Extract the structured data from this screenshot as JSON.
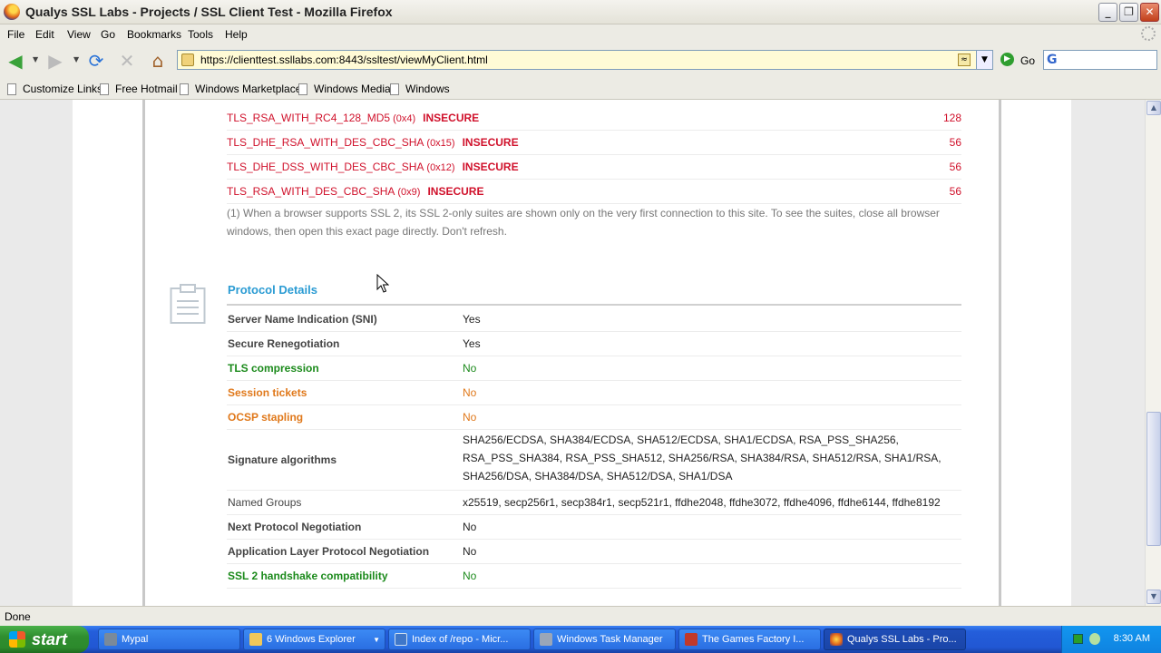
{
  "window": {
    "title": "Qualys SSL Labs - Projects / SSL Client Test - Mozilla Firefox",
    "min": "_",
    "max": "❐",
    "close": "✕"
  },
  "menu": [
    "File",
    "Edit",
    "View",
    "Go",
    "Bookmarks",
    "Tools",
    "Help"
  ],
  "nav": {
    "url": "https://clienttest.ssllabs.com:8443/ssltest/viewMyClient.html",
    "go_label": "Go"
  },
  "bookmarks": [
    "Customize Links",
    "Free Hotmail",
    "Windows Marketplace",
    "Windows Media",
    "Windows"
  ],
  "suites": [
    {
      "name": "TLS_RSA_WITH_RC4_128_MD5",
      "code": "(0x4)",
      "flag": "INSECURE",
      "bits": "128"
    },
    {
      "name": "TLS_DHE_RSA_WITH_DES_CBC_SHA",
      "code": "(0x15)",
      "flag": "INSECURE",
      "bits": "56"
    },
    {
      "name": "TLS_DHE_DSS_WITH_DES_CBC_SHA",
      "code": "(0x12)",
      "flag": "INSECURE",
      "bits": "56"
    },
    {
      "name": "TLS_RSA_WITH_DES_CBC_SHA",
      "code": "(0x9)",
      "flag": "INSECURE",
      "bits": "56"
    }
  ],
  "footnote": "(1) When a browser supports SSL 2, its SSL 2-only suites are shown only on the very first connection to this site. To see the suites, close all browser windows, then open this exact page directly. Don't refresh.",
  "protocol": {
    "title": "Protocol Details",
    "rows": [
      {
        "label": "Server Name Indication (SNI)",
        "value": "Yes",
        "tone": "normal"
      },
      {
        "label": "Secure Renegotiation",
        "value": "Yes",
        "tone": "normal"
      },
      {
        "label": "TLS compression",
        "value": "No",
        "tone": "good"
      },
      {
        "label": "Session tickets",
        "value": "No",
        "tone": "warn"
      },
      {
        "label": "OCSP stapling",
        "value": "No",
        "tone": "warn"
      },
      {
        "label": "Signature algorithms",
        "value": "SHA256/ECDSA, SHA384/ECDSA, SHA512/ECDSA, SHA1/ECDSA, RSA_PSS_SHA256, RSA_PSS_SHA384, RSA_PSS_SHA512, SHA256/RSA, SHA384/RSA, SHA512/RSA, SHA1/RSA, SHA256/DSA, SHA384/DSA, SHA512/DSA, SHA1/DSA",
        "tone": "normal"
      },
      {
        "label": "Named Groups",
        "value": "x25519, secp256r1, secp384r1, secp521r1, ffdhe2048, ffdhe3072, ffdhe4096, ffdhe6144, ffdhe8192",
        "tone": "normal"
      },
      {
        "label": "Next Protocol Negotiation",
        "value": "No",
        "tone": "normal"
      },
      {
        "label": "Application Layer Protocol Negotiation",
        "value": "No",
        "tone": "normal"
      },
      {
        "label": "SSL 2 handshake compatibility",
        "value": "No",
        "tone": "good"
      }
    ]
  },
  "status": "Done",
  "taskbar": {
    "start": "start",
    "tasks": [
      "Mypal",
      "6 Windows Explorer",
      "Index of /repo - Micr...",
      "Windows Task Manager",
      "The Games Factory I...",
      "Qualys SSL Labs - Pro..."
    ],
    "clock": "8:30 AM"
  }
}
